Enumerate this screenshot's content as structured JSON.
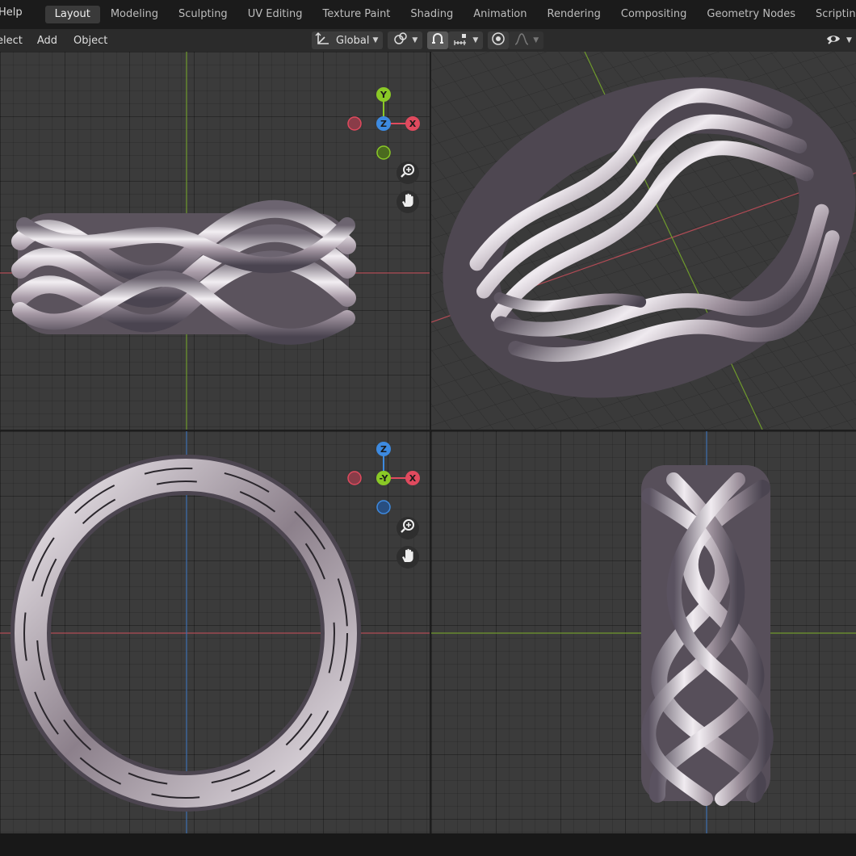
{
  "topbar": {
    "help": "Help",
    "tabs": [
      {
        "label": "Layout",
        "active": true
      },
      {
        "label": "Modeling"
      },
      {
        "label": "Sculpting"
      },
      {
        "label": "UV Editing"
      },
      {
        "label": "Texture Paint"
      },
      {
        "label": "Shading"
      },
      {
        "label": "Animation"
      },
      {
        "label": "Rendering"
      },
      {
        "label": "Compositing"
      },
      {
        "label": "Geometry Nodes"
      },
      {
        "label": "Scripting"
      }
    ],
    "add_tab": "+"
  },
  "header": {
    "menu": [
      "elect",
      "Add",
      "Object"
    ],
    "orientation": "Global",
    "icons": [
      "transform-orientation-icon",
      "pivot-icon",
      "snap-icon",
      "snap-increment-icon",
      "proportional-editing-icon",
      "falloff-icon",
      "view-visibility-icon"
    ]
  },
  "gizmos": {
    "top_left": {
      "top": "Y",
      "center": "Z",
      "right": "X"
    },
    "bottom_left": {
      "top": "Z",
      "center": "-Y",
      "right": "X"
    }
  },
  "colors": {
    "axis_x": "#e04a5e",
    "axis_y": "#8ac926",
    "axis_z": "#3d8ae0",
    "accent_tab": "#3a3a3a"
  }
}
